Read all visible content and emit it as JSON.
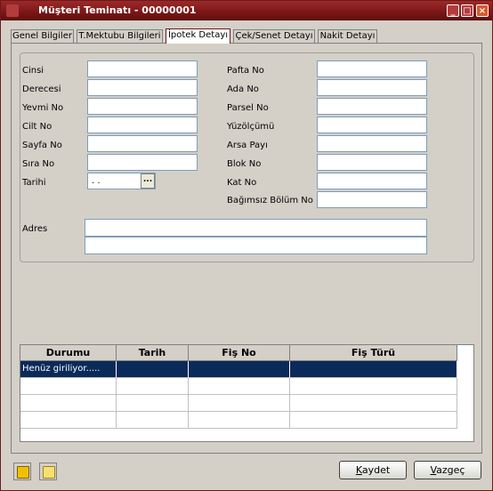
{
  "window": {
    "title": "Müşteri Teminatı - 00000001",
    "buttons": {
      "minimize": "_",
      "maximize": "□",
      "close": "×"
    }
  },
  "tabs": [
    {
      "label": "Genel Bilgiler",
      "active": false
    },
    {
      "label": "T.Mektubu Bilgileri",
      "active": false
    },
    {
      "label": "İpotek Detayı",
      "active": true
    },
    {
      "label": "Çek/Senet Detayı",
      "active": false
    },
    {
      "label": "Nakit Detayı",
      "active": false
    }
  ],
  "form": {
    "left": [
      {
        "label": "Cinsi",
        "value": ""
      },
      {
        "label": "Derecesi",
        "value": ""
      },
      {
        "label": "Yevmi No",
        "value": ""
      },
      {
        "label": "Cilt No",
        "value": ""
      },
      {
        "label": "Sayfa No",
        "value": ""
      },
      {
        "label": "Sıra No",
        "value": ""
      },
      {
        "label": "Tarihi",
        "value": " .  . "
      }
    ],
    "right": [
      {
        "label": "Pafta No",
        "value": ""
      },
      {
        "label": "Ada No",
        "value": ""
      },
      {
        "label": "Parsel No",
        "value": ""
      },
      {
        "label": "Yüzölçümü",
        "value": ""
      },
      {
        "label": "Arsa Payı",
        "value": ""
      },
      {
        "label": "Blok No",
        "value": ""
      },
      {
        "label": "Kat No",
        "value": ""
      },
      {
        "label": "Bağımsız Bölüm No",
        "value": ""
      }
    ],
    "adres": {
      "label": "Adres",
      "line1": "",
      "line2": ""
    },
    "date_button": "..."
  },
  "grid": {
    "columns": [
      "Durumu",
      "Tarih",
      "Fiş No",
      "Fiş Türü"
    ],
    "rows": [
      [
        "Henüz giriliyor.....",
        "",
        "",
        ""
      ],
      [
        "",
        "",
        "",
        ""
      ],
      [
        "",
        "",
        "",
        ""
      ],
      [
        "",
        "",
        "",
        ""
      ]
    ]
  },
  "footer": {
    "save_prefix": "K",
    "save_rest": "aydet",
    "cancel_prefix": "V",
    "cancel_rest": "azgeç"
  },
  "colors": {
    "titlebar": "#7a1616",
    "selection": "#0a2a5a",
    "field_border": "#7f9db9"
  }
}
